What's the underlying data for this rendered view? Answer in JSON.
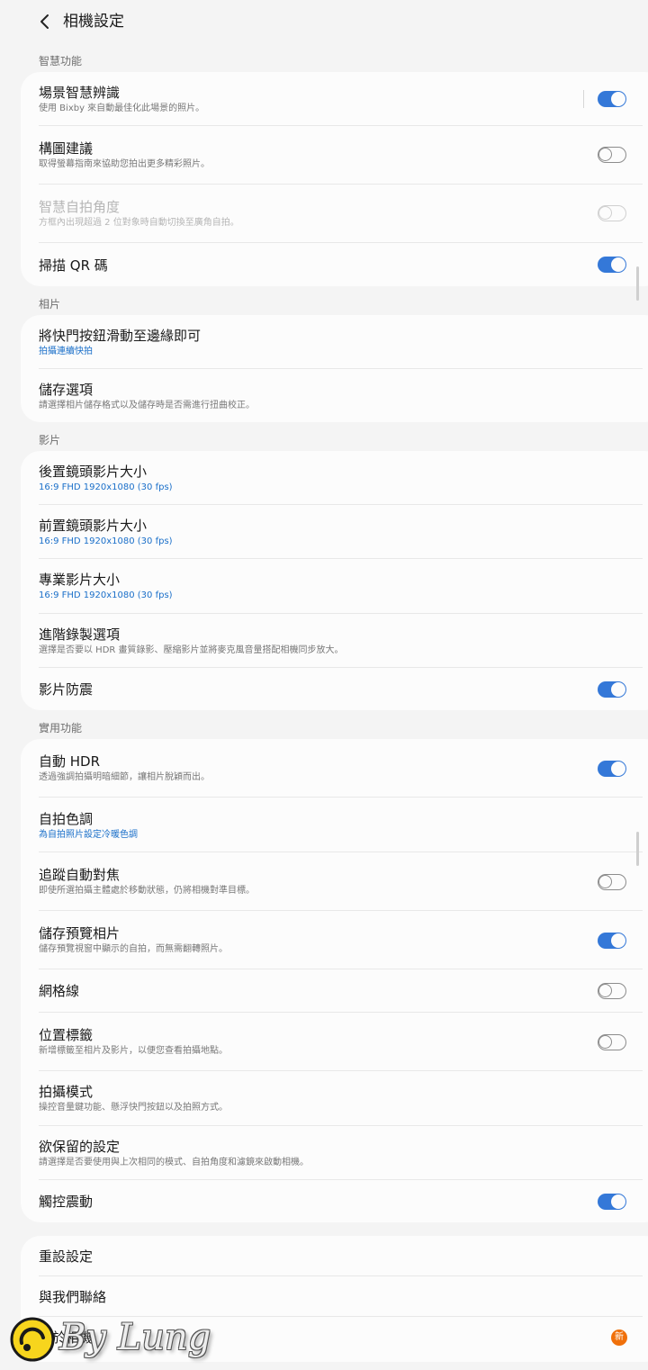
{
  "header": {
    "title": "相機設定",
    "back_icon": "chevron-left-icon"
  },
  "colors": {
    "accent": "#3478d8",
    "link": "#1a6fc9",
    "badge": "#f0700a"
  },
  "sections": {
    "smart": {
      "label": "智慧功能"
    },
    "pictures": {
      "label": "相片"
    },
    "videos": {
      "label": "影片"
    },
    "useful": {
      "label": "實用功能"
    }
  },
  "smart": {
    "scene": {
      "title": "場景智慧辨識",
      "subtitle": "使用 Bixby 來自動最佳化此場景的照片。",
      "on": true
    },
    "composition": {
      "title": "構圖建議",
      "subtitle": "取得螢幕指南來協助您拍出更多精彩照片。",
      "on": false
    },
    "selfie_angle": {
      "title": "智慧自拍角度",
      "subtitle": "方框內出現超過 2 位對象時自動切換至廣角自拍。",
      "on": false,
      "enabled": false
    },
    "qr": {
      "title": "掃描 QR 碼",
      "on": true
    }
  },
  "pictures": {
    "swipe_shutter": {
      "title": "將快門按鈕滑動至邊緣即可",
      "value": "拍攝連續快拍"
    },
    "save_options": {
      "title": "儲存選項",
      "subtitle": "請選擇相片儲存格式以及儲存時是否需進行扭曲校正。"
    }
  },
  "videos": {
    "rear_size": {
      "title": "後置鏡頭影片大小",
      "value": "16:9 FHD 1920x1080 (30 fps)"
    },
    "front_size": {
      "title": "前置鏡頭影片大小",
      "value": "16:9 FHD 1920x1080 (30 fps)"
    },
    "pro_size": {
      "title": "專業影片大小",
      "value": "16:9 FHD 1920x1080 (30 fps)"
    },
    "advanced": {
      "title": "進階錄製選項",
      "subtitle": "選擇是否要以 HDR 畫質錄影、壓縮影片並將麥克風音量搭配相機同步放大。"
    },
    "stabilization": {
      "title": "影片防震",
      "on": true
    }
  },
  "useful": {
    "auto_hdr": {
      "title": "自動 HDR",
      "subtitle": "透過強調拍攝明暗細節，讓相片脫穎而出。",
      "on": true
    },
    "selfie_tone": {
      "title": "自拍色調",
      "value": "為自拍照片設定冷暖色調"
    },
    "tracking_af": {
      "title": "追蹤自動對焦",
      "subtitle": "即使所選拍攝主體處於移動狀態，仍將相機對準目標。",
      "on": false
    },
    "save_preview": {
      "title": "儲存預覽相片",
      "subtitle": "儲存預覽視窗中顯示的自拍，而無需翻轉照片。",
      "on": true
    },
    "grid_lines": {
      "title": "網格線",
      "on": false
    },
    "location_tags": {
      "title": "位置標籤",
      "subtitle": "新增標籤至相片及影片，以便您查看拍攝地點。",
      "on": false
    },
    "shooting_methods": {
      "title": "拍攝模式",
      "subtitle": "操控音量鍵功能、懸浮快門按鈕以及拍照方式。"
    },
    "settings_keep": {
      "title": "欲保留的設定",
      "subtitle": "請選擇是否要使用與上次相同的模式、自拍角度和濾鏡來啟動相機。"
    },
    "vibration": {
      "title": "觸控震動",
      "on": true
    }
  },
  "bottom": {
    "reset": {
      "title": "重設設定"
    },
    "contact": {
      "title": "與我們聯絡"
    },
    "about": {
      "title": "關於相機",
      "badge": "新"
    }
  },
  "watermark": {
    "text": "By Lung"
  }
}
